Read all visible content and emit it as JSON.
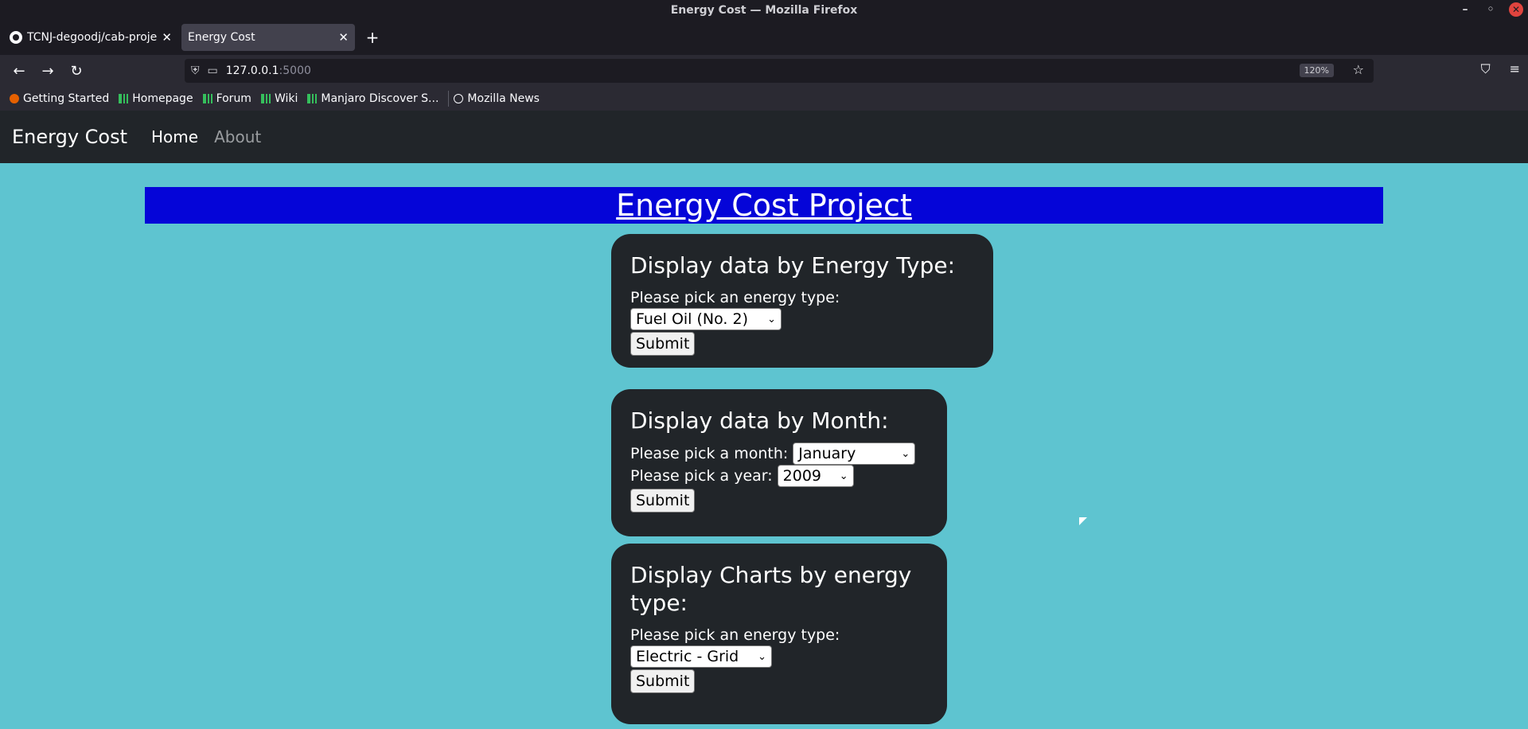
{
  "window": {
    "title": "Energy Cost — Mozilla Firefox"
  },
  "tabs": [
    {
      "label": "TCNJ-degoodj/cab-project",
      "close": "✕"
    },
    {
      "label": "Energy Cost",
      "close": "✕"
    }
  ],
  "toolbar": {
    "back": "←",
    "forward": "→",
    "reload": "↻",
    "url_host": "127.0.0.1",
    "url_port": ":5000",
    "zoom": "120%",
    "star": "☆",
    "pocket": "⛉",
    "menu": "≡",
    "new_tab": "+"
  },
  "bookmarks": [
    "Getting Started",
    "Homepage",
    "Forum",
    "Wiki",
    "Manjaro Discover S...",
    "Mozilla News"
  ],
  "site_nav": {
    "brand": "Energy Cost",
    "links": [
      "Home",
      "About"
    ]
  },
  "banner": {
    "title": "Energy Cost Project"
  },
  "cards": {
    "energy_type": {
      "heading": "Display data by Energy Type:",
      "label": "Please pick an energy type:",
      "selected": "Fuel Oil (No. 2)",
      "submit": "Submit"
    },
    "month": {
      "heading": "Display data by Month:",
      "month_label": "Please pick a month:",
      "month_selected": "January",
      "year_label": "Please pick a year:",
      "year_selected": "2009",
      "submit": "Submit"
    },
    "charts": {
      "heading": "Display Charts by energy type:",
      "label": "Please pick an energy type:",
      "selected": "Electric - Grid",
      "submit": "Submit"
    }
  }
}
